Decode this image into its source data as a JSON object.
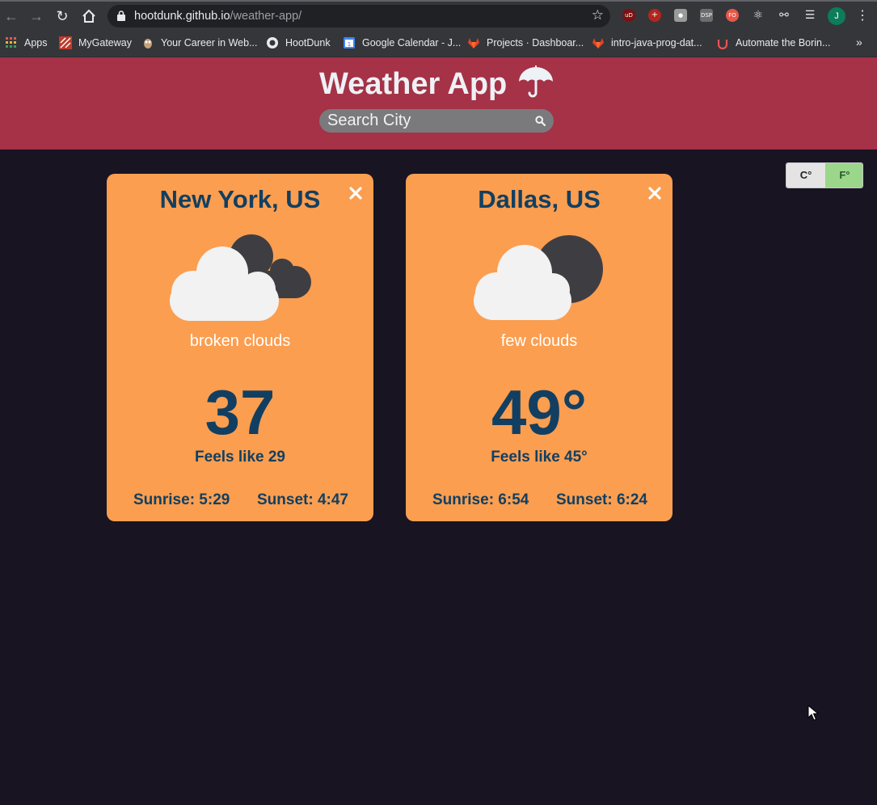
{
  "browser": {
    "url_host": "hootdunk.github.io",
    "url_path": "/weather-app/",
    "avatar_letter": "J",
    "bookmarks": [
      {
        "label": "Apps"
      },
      {
        "label": "MyGateway"
      },
      {
        "label": "Your Career in Web..."
      },
      {
        "label": "HootDunk"
      },
      {
        "label": "Google Calendar - J..."
      },
      {
        "label": "Projects · Dashboar..."
      },
      {
        "label": "intro-java-prog-dat..."
      },
      {
        "label": "Automate the Borin..."
      }
    ],
    "bookmarks_more": "»"
  },
  "app": {
    "title": "Weather App",
    "search_placeholder": "Search City",
    "accent_color": "#a53246",
    "card_color": "#fb9e50"
  },
  "units": {
    "celsius_label": "C°",
    "fahrenheit_label": "F°",
    "selected": "F°"
  },
  "cards": [
    {
      "city": "New York, US",
      "icon": "broken-clouds-icon",
      "description": "broken clouds",
      "temp": "37",
      "feels_like": "Feels like 29",
      "sunrise": "Sunrise: 5:29",
      "sunset": "Sunset: 4:47"
    },
    {
      "city": "Dallas, US",
      "icon": "few-clouds-icon",
      "description": "few clouds",
      "temp": "49°",
      "feels_like": "Feels like 45°",
      "sunrise": "Sunrise: 6:54",
      "sunset": "Sunset: 6:24"
    }
  ]
}
